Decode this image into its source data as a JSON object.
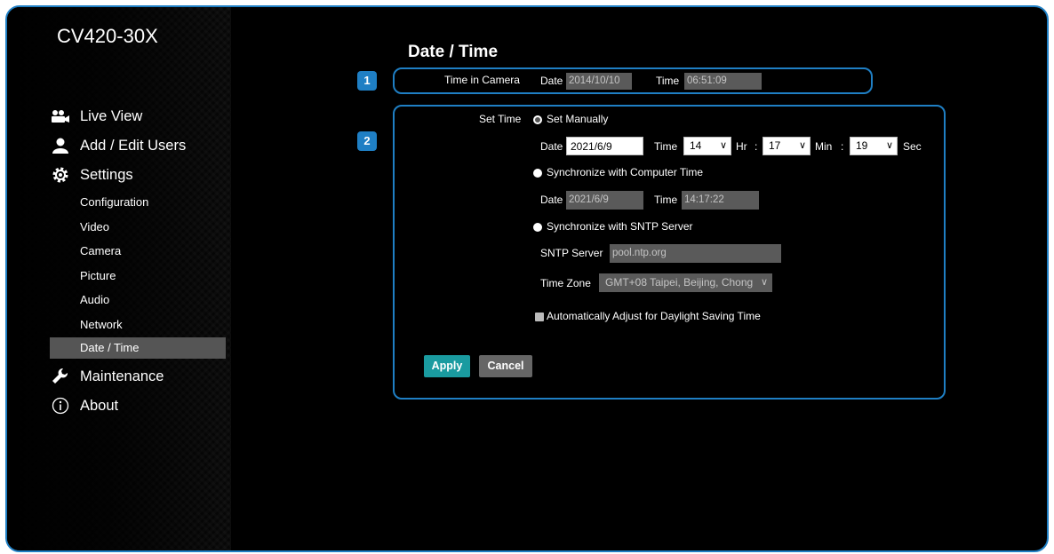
{
  "app": {
    "model": "CV420-30X"
  },
  "nav": {
    "live_view": "Live View",
    "add_edit_users": "Add / Edit Users",
    "settings": "Settings",
    "sub_items": [
      "Configuration",
      "Video",
      "Camera",
      "Picture",
      "Audio",
      "Network",
      "Date / Time"
    ],
    "active_sub": "Date / Time",
    "maintenance": "Maintenance",
    "about": "About"
  },
  "page": {
    "title": "Date / Time",
    "badges": [
      "1",
      "2"
    ]
  },
  "camera_time": {
    "label": "Time in Camera",
    "date_label": "Date",
    "date_value": "2014/10/10",
    "time_label": "Time",
    "time_value": "06:51:09"
  },
  "set_time": {
    "label": "Set Time",
    "manual": {
      "label": "Set Manually",
      "selected": true,
      "date_label": "Date",
      "date_value": "2021/6/9",
      "time_label": "Time",
      "hour": "14",
      "hr_label": "Hr",
      "sep1": ":",
      "minute": "17",
      "min_label": "Min",
      "sep2": ":",
      "second": "19",
      "sec_label": "Sec"
    },
    "computer": {
      "label": "Synchronize with Computer Time",
      "date_label": "Date",
      "date_value": "2021/6/9",
      "time_label": "Time",
      "time_value": "14:17:22"
    },
    "sntp": {
      "label": "Synchronize with SNTP Server",
      "server_label": "SNTP Server",
      "server_value": "pool.ntp.org",
      "timezone_label": "Time Zone",
      "timezone_value": "GMT+08 Taipei, Beijing, Chong"
    },
    "dst_label": "Automatically Adjust for Daylight Saving Time"
  },
  "buttons": {
    "apply": "Apply",
    "cancel": "Cancel"
  },
  "colors": {
    "accent": "#1f7fc4",
    "apply": "#1a9ba0",
    "active_nav": "#555555"
  }
}
